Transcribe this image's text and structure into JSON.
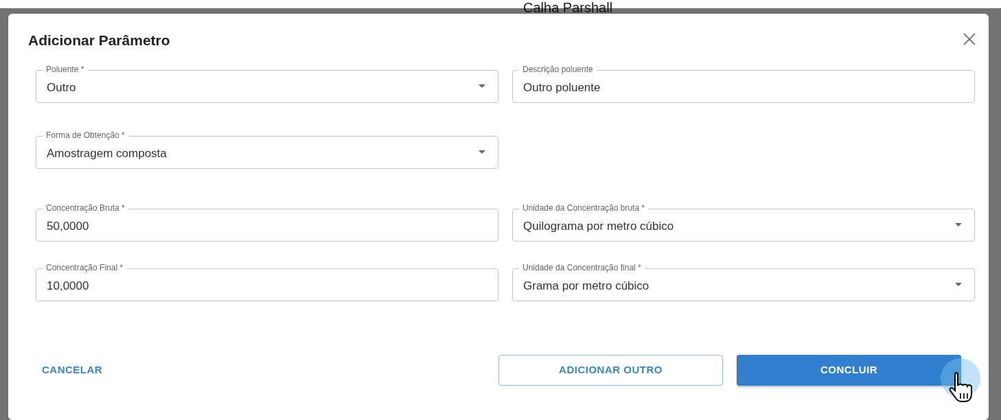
{
  "background": {
    "text": "Calha Parshall"
  },
  "dialog": {
    "title": "Adicionar Parâmetro",
    "rows": [
      [
        {
          "kind": "select",
          "label": "Poluente *",
          "value": "Outro"
        },
        {
          "kind": "text",
          "label": "Descrição poluente",
          "value": "Outro poluente"
        }
      ],
      [
        {
          "kind": "select",
          "label": "Forma de Obtenção *",
          "value": "Amostragem composta"
        }
      ],
      [
        {
          "kind": "text",
          "label": "Concentração Bruta *",
          "value": "50,0000"
        },
        {
          "kind": "select",
          "label": "Unidade da Concentração bruta *",
          "value": "Quilograma por metro cúbico"
        }
      ],
      [
        {
          "kind": "text",
          "label": "Concentração Final *",
          "value": "10,0000"
        },
        {
          "kind": "select",
          "label": "Unidade da Concentração final *",
          "value": "Grama por metro cúbico"
        }
      ]
    ],
    "buttons": [
      {
        "kind": "text",
        "label": "CANCELAR"
      },
      {
        "kind": "outline",
        "label": "ADICIONAR OUTRO"
      },
      {
        "kind": "primary",
        "label": "CONCLUIR"
      }
    ]
  }
}
